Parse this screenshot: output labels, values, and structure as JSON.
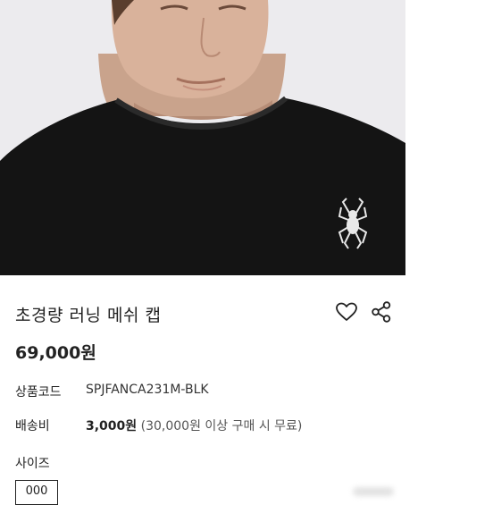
{
  "product": {
    "title": "초경량 러닝 메쉬 캡",
    "price": "69,000원"
  },
  "details": {
    "code_label": "상품코드",
    "code_value": "SPJFANCA231M-BLK",
    "shipping_label": "배송비",
    "shipping_fee": "3,000원",
    "shipping_note": "(30,000원 이상 구매 시 무료)"
  },
  "size": {
    "label": "사이즈",
    "option": "000"
  },
  "icons": {
    "wishlist": "heart-outline-icon",
    "share": "share-icon",
    "logo": "spider-logo-icon"
  },
  "colors": {
    "text": "#222222",
    "photo_background": "#ecebee",
    "shirt": "#141414"
  }
}
